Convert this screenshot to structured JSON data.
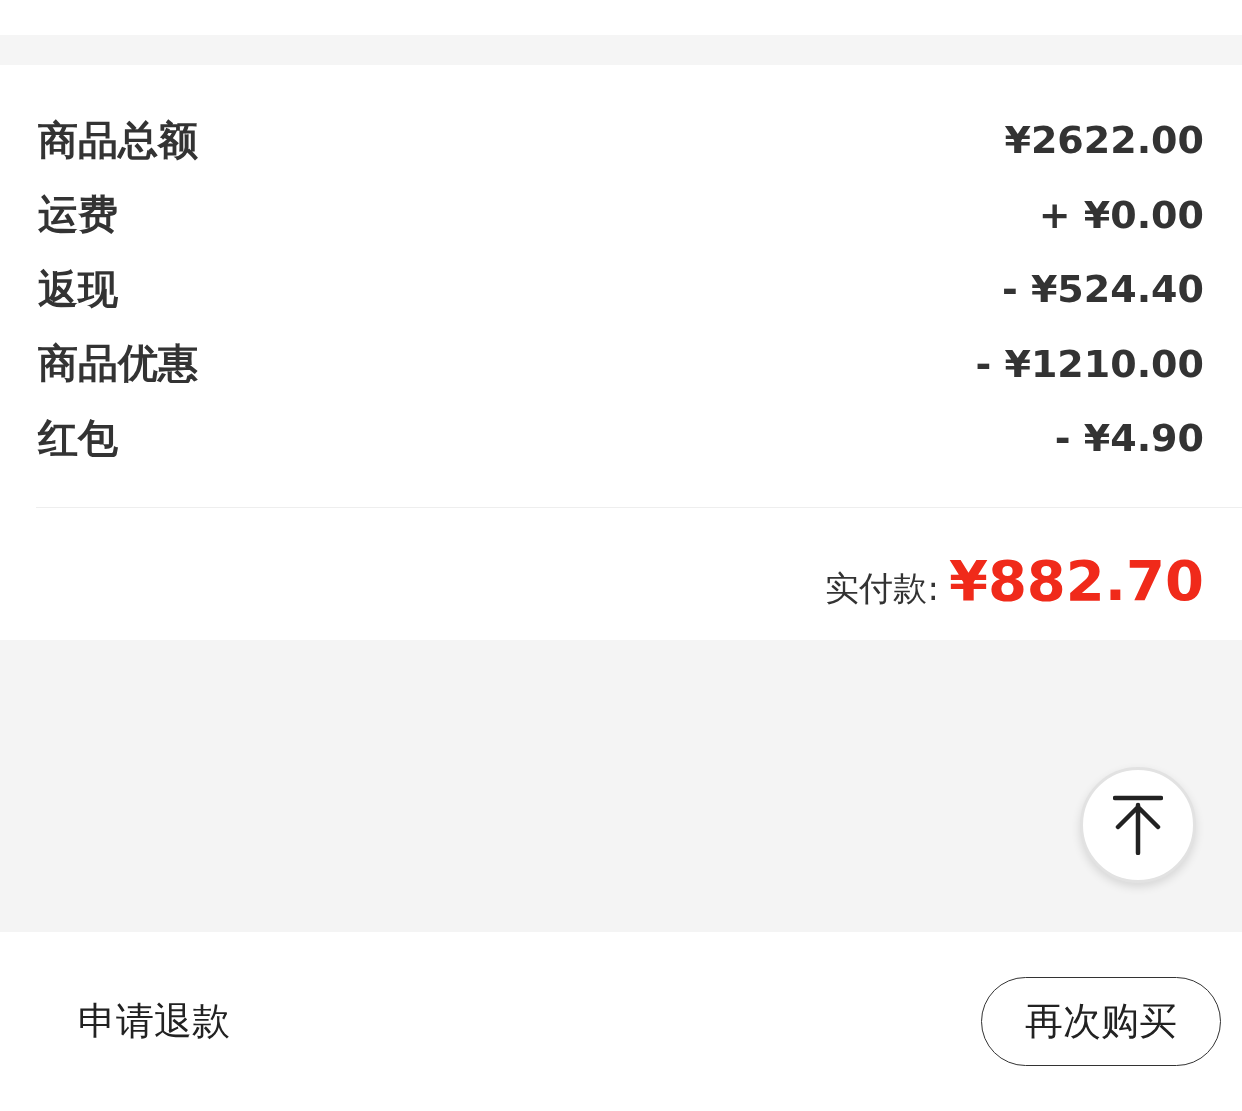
{
  "summary": {
    "rows": [
      {
        "label": "商品总额",
        "value": "¥2622.00"
      },
      {
        "label": "运费",
        "value": "+ ¥0.00"
      },
      {
        "label": "返现",
        "value": "- ¥524.40"
      },
      {
        "label": "商品优惠",
        "value": "- ¥1210.00"
      },
      {
        "label": "红包",
        "value": "- ¥4.90"
      }
    ],
    "total": {
      "label": "实付款:",
      "value": "¥882.70"
    }
  },
  "bottom_bar": {
    "link": "申请退款",
    "button": "再次购买"
  }
}
